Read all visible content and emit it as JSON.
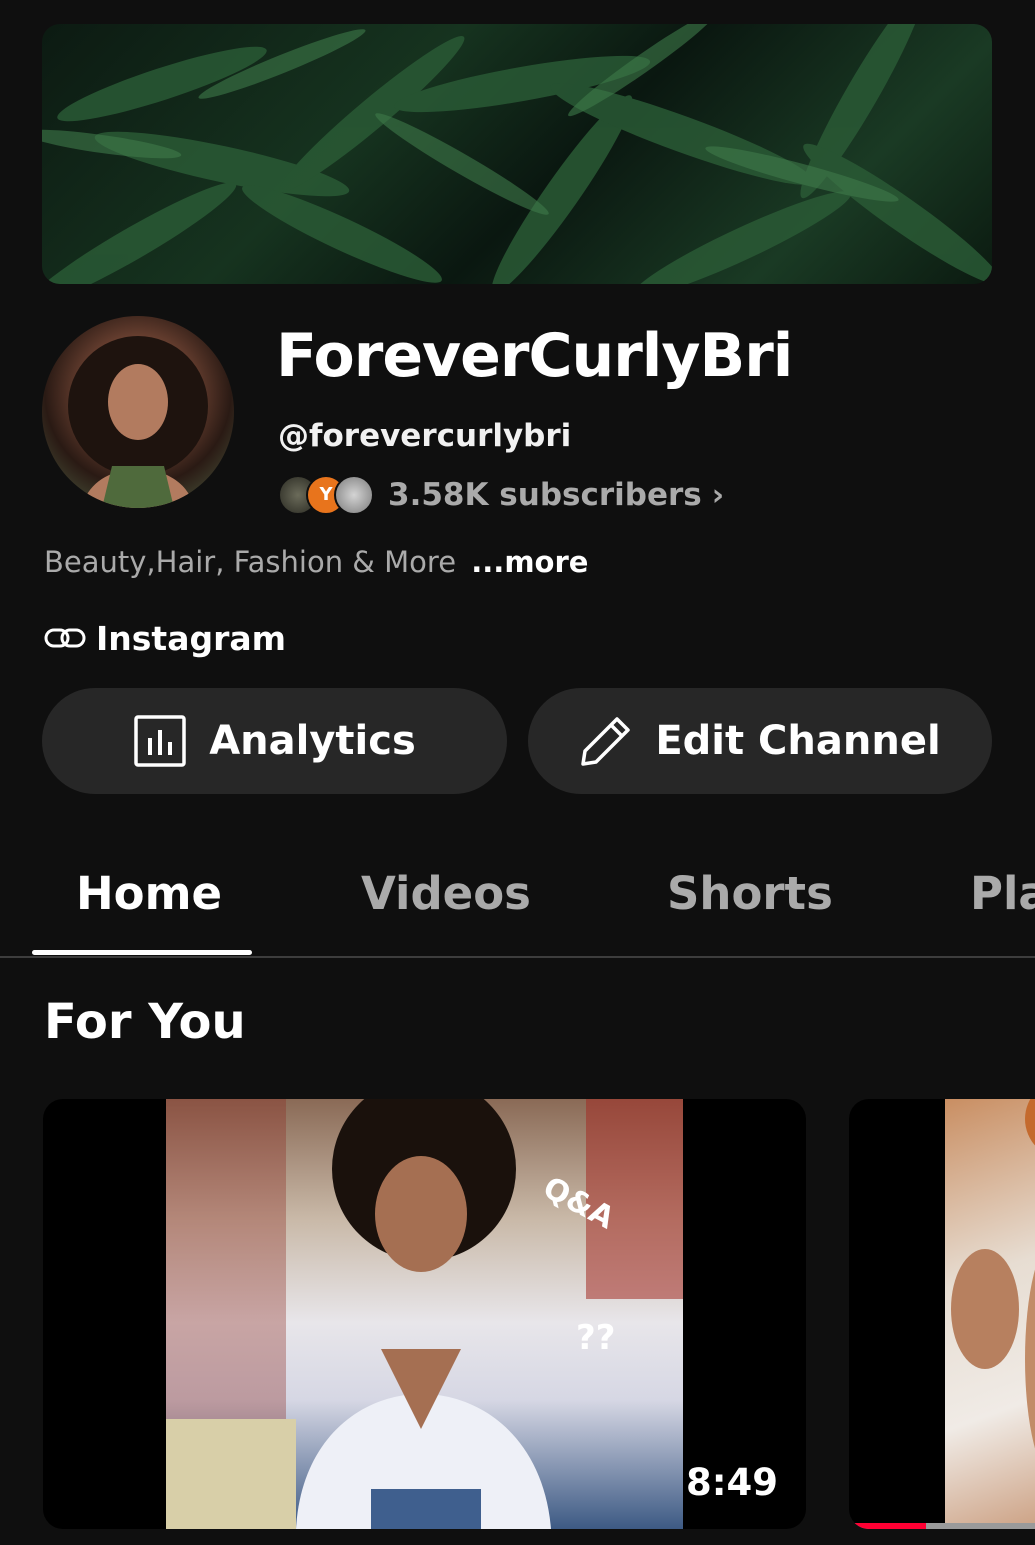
{
  "channel": {
    "name": "ForeverCurlyBri",
    "handle": "@forevercurlybri",
    "subscribers": "3.58K subscribers",
    "subscriber_avatar_initial": "Y",
    "description": "Beauty,Hair, Fashion & More",
    "more_label": "...more",
    "link_label": "Instagram"
  },
  "actions": {
    "analytics_label": "Analytics",
    "edit_label": "Edit Channel"
  },
  "tabs": [
    {
      "label": "Home",
      "active": true
    },
    {
      "label": "Videos",
      "active": false
    },
    {
      "label": "Shorts",
      "active": false
    },
    {
      "label": "Pla",
      "active": false
    }
  ],
  "section": {
    "title": "For You"
  },
  "videos": [
    {
      "duration": "8:49",
      "thumbnail_text": "Q&A"
    },
    {
      "watched_progress": 0.35
    }
  ],
  "colors": {
    "background": "#0f0f0f",
    "button_bg": "#272727",
    "secondary_text": "#aaaaaa",
    "progress_red": "#ff0033"
  },
  "icons": [
    "link-icon",
    "analytics-icon",
    "pencil-icon",
    "chevron-right-icon"
  ]
}
